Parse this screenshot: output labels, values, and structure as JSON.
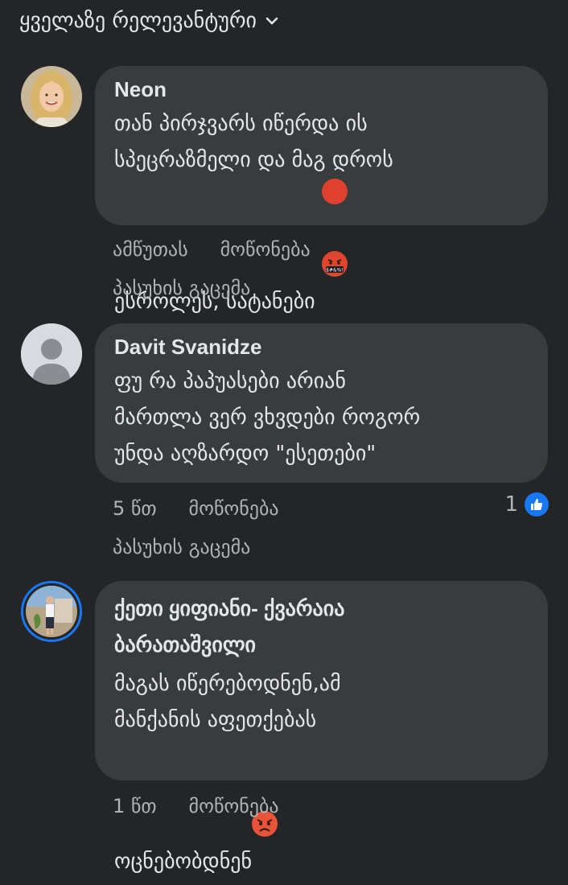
{
  "sort": {
    "label": "ყველაზე რელევანტური"
  },
  "comments": [
    {
      "author": "Neon",
      "text": "თან პირჯვარს იწერდა ის\nსპეცრაზმელი და მაგ დროს\nესროლეს, სატანები",
      "emoji": "cursing-face-icon",
      "time": "ამწუთას",
      "like_label": "მოწონება",
      "reply_label": "პასუხის გაცემა"
    },
    {
      "author": "Davit Svanidze",
      "text": "ფუ რა პაპუასები არიან\nმართლა ვერ ვხვდები როგორ\nუნდა აღზარდო \"ესეთები\"",
      "time": "5 წთ",
      "like_label": "მოწონება",
      "reply_label": "პასუხის გაცემა",
      "reaction_count": "1",
      "reaction_icon": "like-icon"
    },
    {
      "author": "ქეთი ყიფიანი- ქვარაია\nბარათაშვილი",
      "text": "მაგას იწერებოდნენ,ამ\nმანქანის აფეთქებას\nოცნებობდნენ",
      "emoji": "angry-face-icon",
      "time": "1 წთ",
      "like_label": "მოწონება"
    }
  ],
  "colors": {
    "background": "#242526",
    "bubble": "#3a3b3c",
    "meta": "#b0b3b8",
    "like_blue": "#1877f2",
    "story_ring": "#1877f2"
  }
}
